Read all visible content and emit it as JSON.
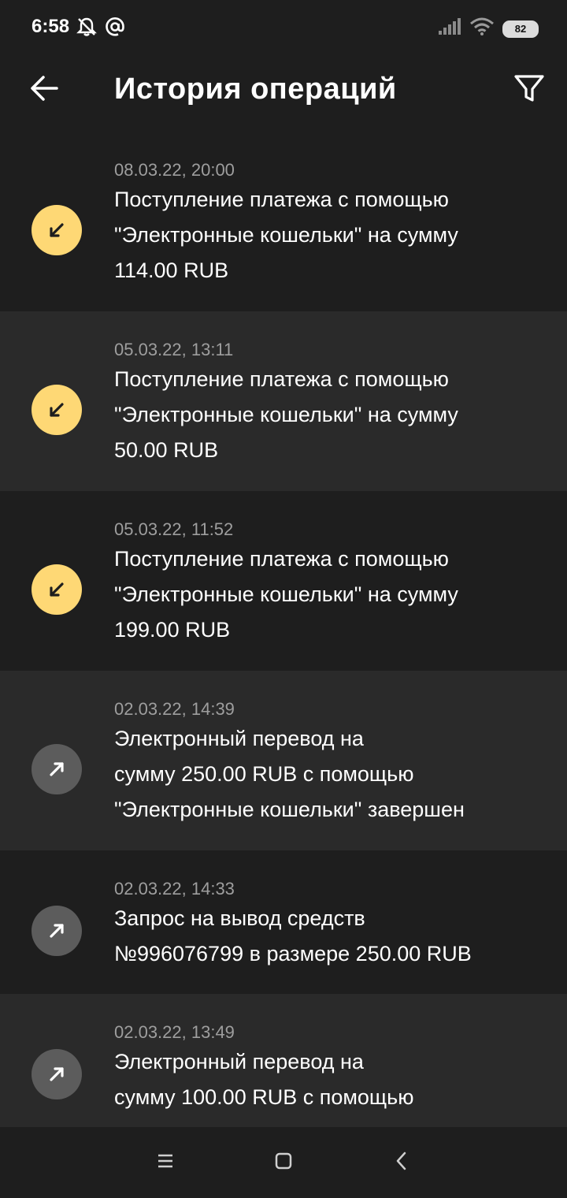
{
  "status_bar": {
    "time": "6:58",
    "left_icons": [
      "mute-alarm-icon",
      "at-sign-icon"
    ],
    "right_icons": [
      "signal-icon",
      "wifi-icon"
    ],
    "battery_level": "82"
  },
  "header": {
    "title": "История операций",
    "back_icon": "arrow-left-icon",
    "filter_icon": "filter-icon"
  },
  "operations": [
    {
      "date": "08.03.22, 20:00",
      "lines": [
        "Поступление платежа с помощью",
        "\"Электронные кошельки\" на сумму",
        "114.00 RUB"
      ],
      "direction": "incoming"
    },
    {
      "date": "05.03.22, 13:11",
      "lines": [
        "Поступление платежа с помощью",
        "\"Электронные кошельки\" на сумму",
        "50.00 RUB"
      ],
      "direction": "incoming"
    },
    {
      "date": "05.03.22, 11:52",
      "lines": [
        "Поступление платежа с помощью",
        "\"Электронные кошельки\" на сумму",
        "199.00 RUB"
      ],
      "direction": "incoming"
    },
    {
      "date": "02.03.22, 14:39",
      "lines": [
        "Электронный перевод на",
        "сумму 250.00 RUB с помощью",
        "\"Электронные кошельки\" завершен"
      ],
      "direction": "outgoing"
    },
    {
      "date": "02.03.22, 14:33",
      "lines": [
        "Запрос на вывод средств",
        "№996076799 в размере 250.00 RUB"
      ],
      "direction": "outgoing"
    },
    {
      "date": "02.03.22, 13:49",
      "lines": [
        "Электронный перевод на",
        "сумму 100.00 RUB с помощью"
      ],
      "direction": "outgoing"
    }
  ],
  "nav": {
    "buttons": [
      "menu-icon",
      "home-icon",
      "back-icon"
    ]
  },
  "colors": {
    "background": "#1e1e1e",
    "row_alt": "#2a2a2a",
    "incoming_icon_bg": "#fed875",
    "outgoing_icon_bg": "#5c5c5c",
    "date_text": "#9e9e9e"
  }
}
